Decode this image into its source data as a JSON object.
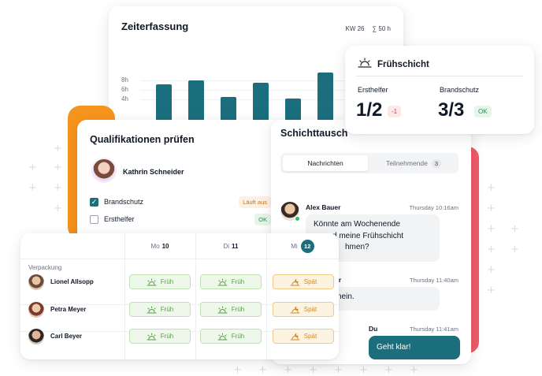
{
  "colors": {
    "teal": "#1b6f7d",
    "orange": "#f7941d",
    "red": "#ef5b6a",
    "ok_green": "#2f8a4e",
    "warn_orange": "#c2751b"
  },
  "time_card": {
    "title": "Zeiterfassung",
    "week": "KW 26",
    "total": "∑ 50 h",
    "y_ticks": [
      "8h",
      "6h",
      "4h"
    ]
  },
  "chart_data": {
    "type": "bar",
    "title": "Zeiterfassung",
    "ylim": [
      0,
      10
    ],
    "y_ticks": [
      "8h",
      "6h",
      "4h"
    ],
    "values": [
      7.2,
      8.0,
      4.6,
      7.5,
      4.3,
      9.5
    ],
    "grid": true
  },
  "qualifications": {
    "title": "Qualifikationen prüfen",
    "person": "Kathrin Schneider",
    "items": [
      {
        "label": "Brandschutz",
        "checked": true,
        "badge": "Läuft aus",
        "badge_type": "warn"
      },
      {
        "label": "Ersthelfer",
        "checked": false,
        "badge": "OK",
        "badge_type": "ok"
      }
    ]
  },
  "swap": {
    "title": "Schichttausch",
    "tabs": {
      "messages": "Nachrichten",
      "participants": "Teilnehmende",
      "participants_count": "3"
    },
    "messages": [
      {
        "sender": "Alex Bauer",
        "time": "Thursday 10:16am",
        "text_lines": [
          "Könnte am Wochenende",
          "d meine Frühschicht",
          "hmen?"
        ]
      },
      {
        "sender": "ner",
        "time": "Thursday 11:40am",
        "text": "nein."
      },
      {
        "sender": "Du",
        "time": "Thursday 11:41am",
        "text": "Geht klar!"
      }
    ]
  },
  "shift": {
    "title": "Frühschicht",
    "stats": [
      {
        "label": "Ersthelfer",
        "value": "1/2",
        "badge": "-1",
        "badge_type": "neg"
      },
      {
        "label": "Brandschutz",
        "value": "3/3",
        "badge": "OK",
        "badge_type": "ok"
      }
    ]
  },
  "schedule": {
    "days": [
      {
        "abbr": "Mo",
        "num": "10"
      },
      {
        "abbr": "Di",
        "num": "11"
      },
      {
        "abbr": "Mi",
        "num": "12"
      }
    ],
    "group": "Verpackung",
    "rows": [
      {
        "name": "Lionel Allsopp",
        "shifts": [
          "Früh",
          "Früh",
          "Spät"
        ]
      },
      {
        "name": "Petra Meyer",
        "shifts": [
          "Früh",
          "Früh",
          "Spät"
        ]
      },
      {
        "name": "Carl Beyer",
        "shifts": [
          "Früh",
          "Früh",
          "Spät"
        ]
      }
    ]
  }
}
